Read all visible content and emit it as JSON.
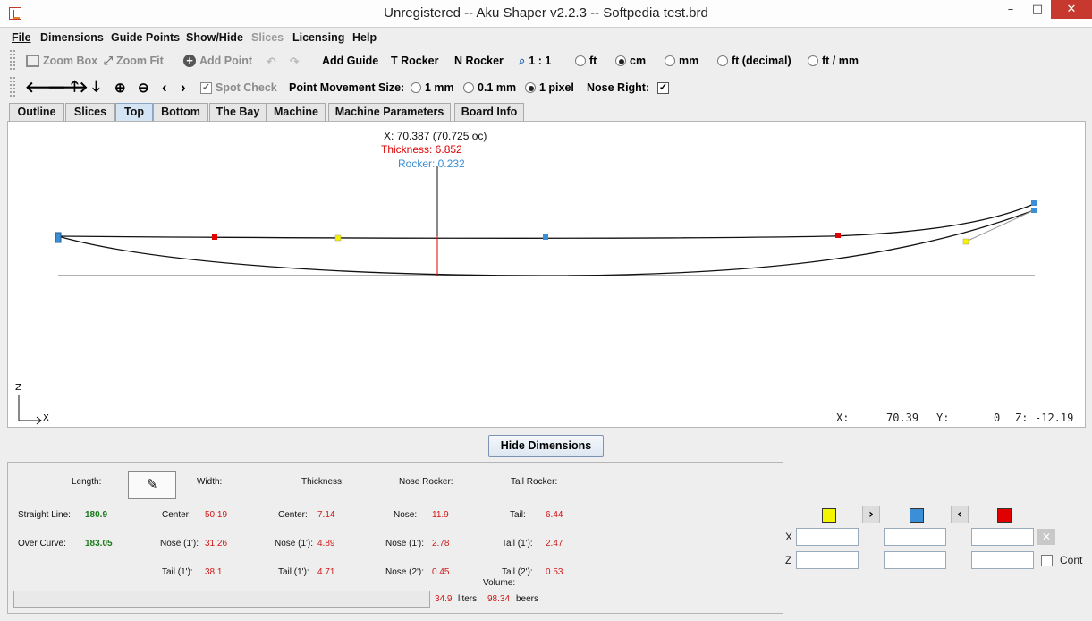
{
  "window": {
    "title": "Unregistered -- Aku Shaper v2.2.3  --  Softpedia test.brd",
    "minimize": "–",
    "maximize": "□",
    "close": "✕"
  },
  "menu": [
    {
      "label": "File",
      "enabled": true
    },
    {
      "label": "Dimensions",
      "enabled": true
    },
    {
      "label": "Guide Points",
      "enabled": true
    },
    {
      "label": "Show/Hide",
      "enabled": true
    },
    {
      "label": "Slices",
      "enabled": false
    },
    {
      "label": "Licensing",
      "enabled": true
    },
    {
      "label": "Help",
      "enabled": true
    }
  ],
  "toolbar1": {
    "zoom_box": "Zoom Box",
    "zoom_fit": "Zoom Fit",
    "add_point": "Add Point",
    "add_guide": "Add Guide",
    "t_rocker": "T Rocker",
    "n_rocker": "N Rocker",
    "scale": "1 : 1",
    "units": [
      {
        "label": "ft",
        "selected": false
      },
      {
        "label": "cm",
        "selected": true
      },
      {
        "label": "mm",
        "selected": false
      },
      {
        "label": "ft (decimal)",
        "selected": false
      },
      {
        "label": "ft / mm",
        "selected": false
      }
    ]
  },
  "toolbar2": {
    "spot_check": "Spot Check",
    "point_movement_label": "Point Movement Size:",
    "movement": [
      {
        "label": "1 mm",
        "selected": false
      },
      {
        "label": "0.1 mm",
        "selected": false
      },
      {
        "label": "1 pixel",
        "selected": true
      }
    ],
    "nose_right_label": "Nose Right:",
    "nose_right_checked": true
  },
  "tabs": [
    {
      "label": "Outline",
      "selected": false
    },
    {
      "label": "Slices",
      "selected": false
    },
    {
      "label": "Top",
      "selected": true
    },
    {
      "label": "Bottom",
      "selected": false
    },
    {
      "label": "The Bay",
      "selected": false
    },
    {
      "label": "Machine",
      "selected": false
    },
    {
      "label": "Machine Parameters",
      "selected": false
    },
    {
      "label": "Board Info",
      "selected": false
    }
  ],
  "canvas": {
    "readout_x": "X: 70.387 (70.725 oc)",
    "readout_thickness": "Thickness: 6.852",
    "readout_rocker": "Rocker: 0.232",
    "axis_z": "Z",
    "axis_x": "X",
    "status_x_label": "X:",
    "status_x": "70.39",
    "status_y_label": "Y:",
    "status_y": "0",
    "status_z_label": "Z:",
    "status_z": "-12.19",
    "colors": {
      "red": "#e00000",
      "yellow": "#f4f400",
      "blue": "#3a8fd6"
    }
  },
  "dimensions": {
    "toggle_button": "Hide Dimensions",
    "length_label": "Length:",
    "width_label": "Width:",
    "thickness_label": "Thickness:",
    "nose_rocker_label": "Nose Rocker:",
    "tail_rocker_label": "Tail Rocker:",
    "straight_line_label": "Straight Line:",
    "straight_line_value": "180.9",
    "over_curve_label": "Over Curve:",
    "over_curve_value": "183.05",
    "width_center_label": "Center:",
    "width_center": "50.19",
    "width_nose_label": "Nose (1'):",
    "width_nose": "31.26",
    "width_tail_label": "Tail (1'):",
    "width_tail": "38.1",
    "thick_center_label": "Center:",
    "thick_center": "7.14",
    "thick_nose_label": "Nose (1'):",
    "thick_nose": "4.89",
    "thick_tail_label": "Tail (1'):",
    "thick_tail": "4.71",
    "nose_rocker_nose_label": "Nose:",
    "nose_rocker_nose": "11.9",
    "nose_rocker_1_label": "Nose (1'):",
    "nose_rocker_1": "2.78",
    "nose_rocker_2_label": "Nose (2'):",
    "nose_rocker_2": "0.45",
    "tail_rocker_tail_label": "Tail:",
    "tail_rocker_tail": "6.44",
    "tail_rocker_1_label": "Tail (1'):",
    "tail_rocker_1": "2.47",
    "tail_rocker_2_label": "Tail (2'):",
    "tail_rocker_2": "0.53",
    "volume_label": "Volume:",
    "volume_liters": "34.9",
    "liters_label": "liters",
    "volume_beers": "98.34",
    "beers_label": "beers"
  },
  "point_editor": {
    "x_label": "X",
    "z_label": "Z",
    "cont_label": "Cont",
    "cont_checked": false
  }
}
